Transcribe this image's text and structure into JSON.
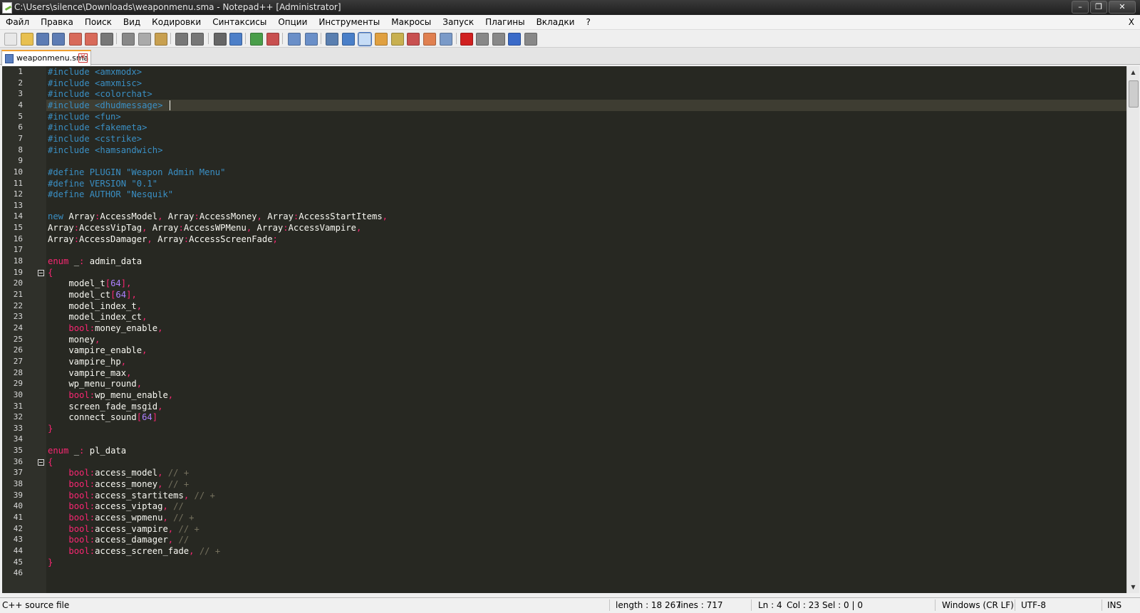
{
  "window": {
    "title": "C:\\Users\\silence\\Downloads\\weaponmenu.sma - Notepad++ [Administrator]"
  },
  "menu": {
    "items": [
      "Файл",
      "Правка",
      "Вид",
      "Поиск",
      "Кодировки",
      "Синтаксисы",
      "Опции",
      "Инструменты",
      "Макросы",
      "Запуск",
      "Плагины",
      "Вкладки",
      "?"
    ],
    "close": "X"
  },
  "toolbar": {
    "icons": [
      "new-file-icon",
      "open-file-icon",
      "save-icon",
      "save-all-icon",
      "close-file-icon",
      "close-all-icon",
      "print-icon",
      "cut-icon",
      "copy-icon",
      "paste-icon",
      "undo-icon",
      "redo-icon",
      "find-icon",
      "replace-icon",
      "zoom-in-icon",
      "zoom-out-icon",
      "sync-vertical-icon",
      "sync-horizontal-icon",
      "word-wrap-icon",
      "show-all-chars-icon",
      "indent-guide-icon",
      "user-defined-language-icon",
      "doc-map-icon",
      "function-list-icon",
      "folder-as-workspace-icon",
      "monitoring-icon",
      "record-macro-icon",
      "stop-macro-icon",
      "play-macro-icon",
      "run-macro-multiple-icon",
      "save-macro-icon"
    ]
  },
  "tab": {
    "label": "weaponmenu.sma",
    "close": "✕"
  },
  "editor": {
    "colors": {
      "background": "#272822",
      "preprocessor": "#3a8fc4",
      "keyword": "#f92672",
      "text": "#f8f8f2",
      "comment": "#75715e",
      "number": "#ae81ff"
    },
    "lines": [
      {
        "n": "1",
        "t": "#include <amxmodx>"
      },
      {
        "n": "2",
        "t": "#include <amxmisc>"
      },
      {
        "n": "3",
        "t": "#include <colorchat>"
      },
      {
        "n": "4",
        "t": "#include <dhudmessage>"
      },
      {
        "n": "5",
        "t": "#include <fun>"
      },
      {
        "n": "6",
        "t": "#include <fakemeta>"
      },
      {
        "n": "7",
        "t": "#include <cstrike>"
      },
      {
        "n": "8",
        "t": "#include <hamsandwich>"
      },
      {
        "n": "9",
        "t": ""
      },
      {
        "n": "10",
        "t": "#define PLUGIN \"Weapon Admin Menu\""
      },
      {
        "n": "11",
        "t": "#define VERSION \"0.1\""
      },
      {
        "n": "12",
        "t": "#define AUTHOR \"Nesquik\""
      },
      {
        "n": "13",
        "t": ""
      },
      {
        "n": "14",
        "t": "new Array:AccessModel, Array:AccessMoney, Array:AccessStartItems,"
      },
      {
        "n": "15",
        "t": "Array:AccessVipTag, Array:AccessWPMenu, Array:AccessVampire,"
      },
      {
        "n": "16",
        "t": "Array:AccessDamager, Array:AccessScreenFade;"
      },
      {
        "n": "17",
        "t": ""
      },
      {
        "n": "18",
        "t": "enum _: admin_data"
      },
      {
        "n": "19",
        "t": "{"
      },
      {
        "n": "20",
        "t": "    model_t[64],"
      },
      {
        "n": "21",
        "t": "    model_ct[64],"
      },
      {
        "n": "22",
        "t": "    model_index_t,"
      },
      {
        "n": "23",
        "t": "    model_index_ct,"
      },
      {
        "n": "24",
        "t": "    bool:money_enable,"
      },
      {
        "n": "25",
        "t": "    money,"
      },
      {
        "n": "26",
        "t": "    vampire_enable,"
      },
      {
        "n": "27",
        "t": "    vampire_hp,"
      },
      {
        "n": "28",
        "t": "    vampire_max,"
      },
      {
        "n": "29",
        "t": "    wp_menu_round,"
      },
      {
        "n": "30",
        "t": "    bool:wp_menu_enable,"
      },
      {
        "n": "31",
        "t": "    screen_fade_msgid,"
      },
      {
        "n": "32",
        "t": "    connect_sound[64]"
      },
      {
        "n": "33",
        "t": "}"
      },
      {
        "n": "34",
        "t": ""
      },
      {
        "n": "35",
        "t": "enum _: pl_data"
      },
      {
        "n": "36",
        "t": "{"
      },
      {
        "n": "37",
        "t": "    bool:access_model, // +"
      },
      {
        "n": "38",
        "t": "    bool:access_money, // +"
      },
      {
        "n": "39",
        "t": "    bool:access_startitems, // +"
      },
      {
        "n": "40",
        "t": "    bool:access_viptag, //"
      },
      {
        "n": "41",
        "t": "    bool:access_wpmenu, // +"
      },
      {
        "n": "42",
        "t": "    bool:access_vampire, // +"
      },
      {
        "n": "43",
        "t": "    bool:access_damager, //"
      },
      {
        "n": "44",
        "t": "    bool:access_screen_fade, // +"
      },
      {
        "n": "45",
        "t": "}"
      },
      {
        "n": "46",
        "t": ""
      }
    ]
  },
  "status": {
    "filetype": "C++ source file",
    "length": "length : 18 267",
    "lines": "lines : 717",
    "ln": "Ln : 4",
    "col": "Col : 23",
    "sel": "Sel : 0 | 0",
    "eol": "Windows (CR LF)",
    "encoding": "UTF-8",
    "mode": "INS"
  }
}
